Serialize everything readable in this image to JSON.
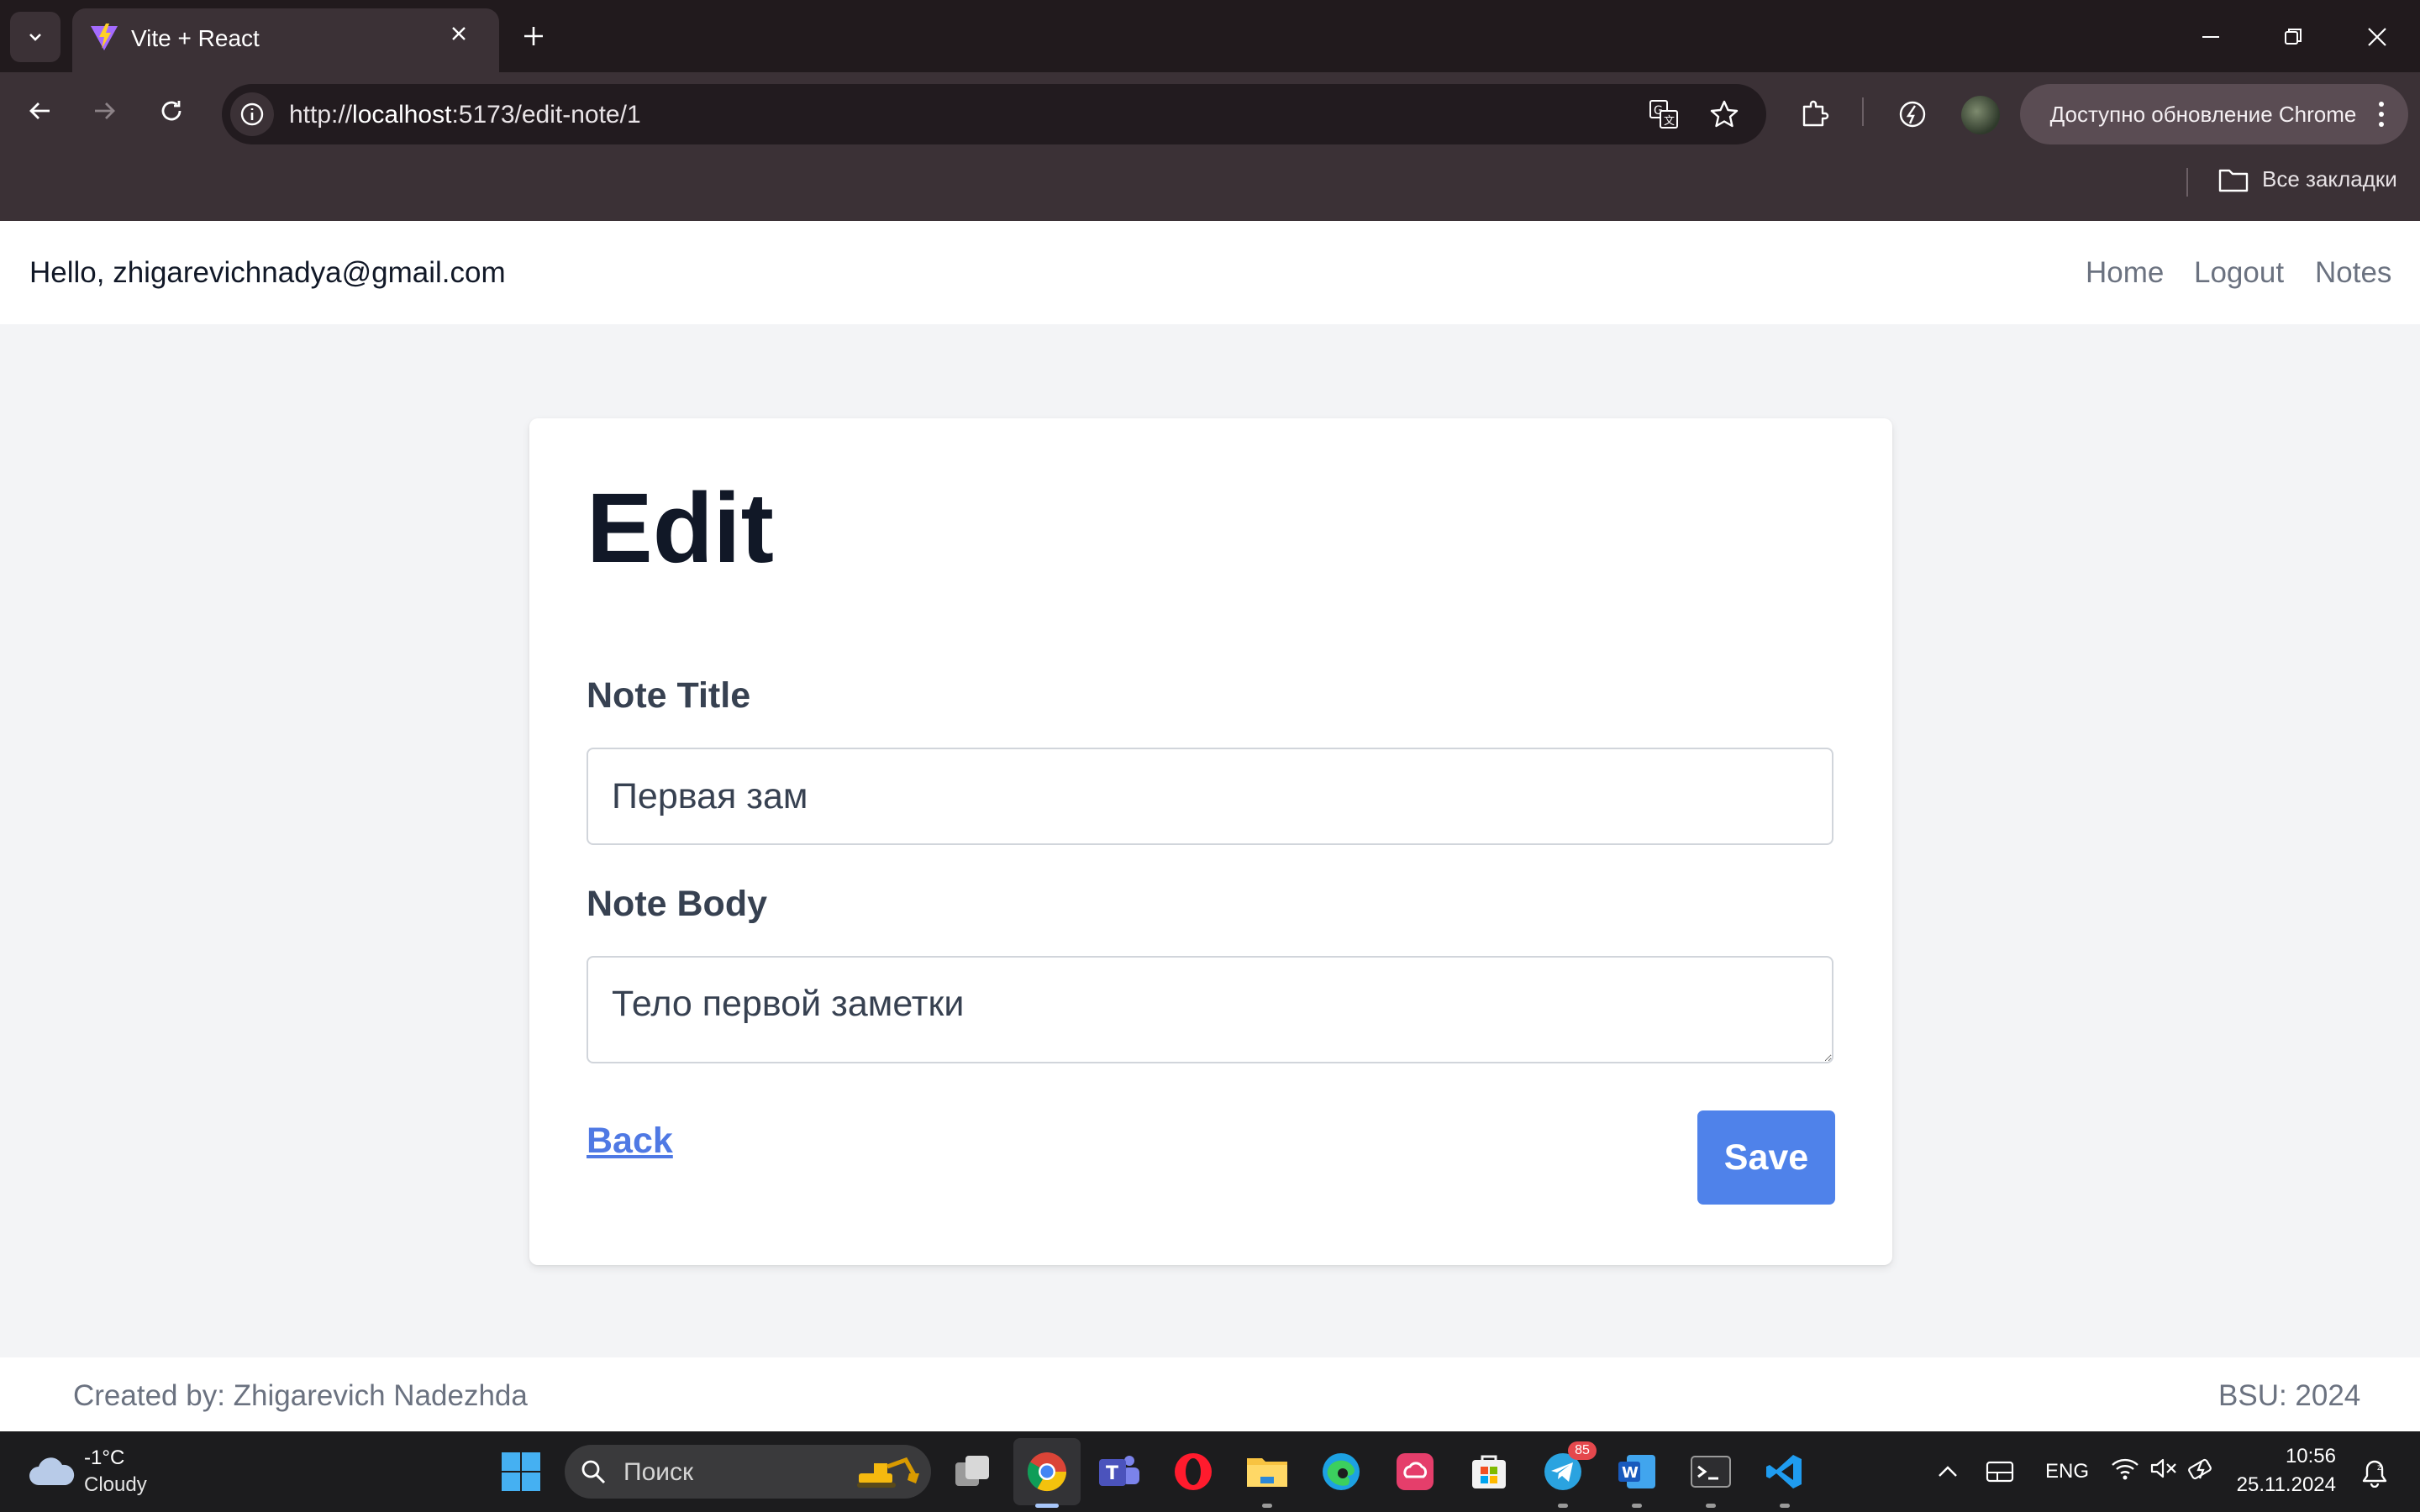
{
  "browser": {
    "tab": {
      "title": "Vite + React"
    },
    "address": {
      "scheme": "http://",
      "host": "localhost",
      "rest": ":5173/edit-note/1"
    },
    "update_chip": "Доступно обновление Chrome",
    "bookmarks_label": "Все закладки",
    "colors": {
      "tabstrip": "#211a1d",
      "toolbar": "#3b3136"
    }
  },
  "header": {
    "greeting": "Hello, zhigarevichnadya@gmail.com",
    "nav": [
      "Home",
      "Logout",
      "Notes"
    ]
  },
  "form": {
    "title": "Edit",
    "title_label": "Note Title",
    "title_value": "Первая зам",
    "body_label": "Note Body",
    "body_value": "Тело первой заметки",
    "back": "Back",
    "save": "Save",
    "accent_color": "#4f82ea"
  },
  "footer": {
    "left": "Created by: Zhigarevich Nadezhda",
    "right": "BSU: 2024"
  },
  "taskbar": {
    "weather": {
      "temp": "-1°C",
      "condition": "Cloudy"
    },
    "search_placeholder": "Поиск",
    "telegram_badge": "85",
    "language": "ENG",
    "time": "10:56",
    "date": "25.11.2024"
  }
}
